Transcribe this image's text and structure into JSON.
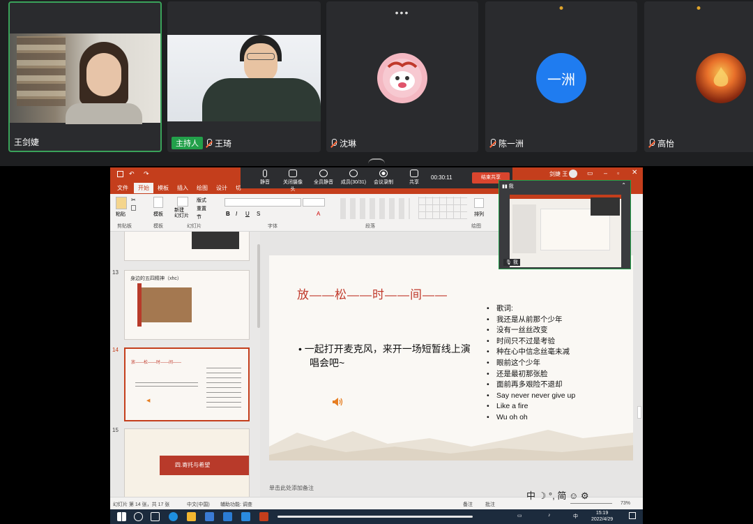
{
  "meeting": {
    "participants": [
      {
        "name": "王剑婕",
        "host": false
      },
      {
        "name": "王琦",
        "host": true,
        "host_badge": "主持人"
      },
      {
        "name": "沈琳"
      },
      {
        "name": "陈一洲",
        "avatar_text": "一洲"
      },
      {
        "name": "高怡"
      }
    ],
    "controls": [
      {
        "label": "静音",
        "icon": "mic-icon"
      },
      {
        "label": "关闭摄像头",
        "icon": "camera-icon"
      },
      {
        "label": "全员静音",
        "icon": "mute-all-icon"
      },
      {
        "label": "成员(30/31)",
        "icon": "members-icon"
      },
      {
        "label": "会议录制",
        "icon": "record-icon"
      },
      {
        "label": "共享",
        "icon": "share-icon"
      }
    ],
    "timer": "00:30:11",
    "stop_share_label": "结束共享",
    "preview_header_icon": "我",
    "preview_mic_label": "我",
    "colors": {
      "accent": "#22a04a",
      "stop": "#d9452e",
      "avatar_blue": "#1f7cf0"
    }
  },
  "ppt": {
    "user_name": "剑婕 王",
    "tabs": [
      "文件",
      "开始",
      "模板",
      "插入",
      "绘图",
      "设计",
      "切"
    ],
    "active_tab": "开始",
    "ribbon": {
      "paste": "粘贴",
      "template": "模板",
      "new_slide": "新建\n幻灯片",
      "layout": "版式",
      "reset": "重置",
      "section": "节",
      "groups": [
        "剪贴板",
        "模板",
        "幻灯片",
        "字体",
        "段落",
        "绘图"
      ],
      "arrange": "排列"
    },
    "thumbnails": [
      {
        "num": "13",
        "title": "身边的五四精神（xhc）"
      },
      {
        "num": "14",
        "title": "放——松——时——间——",
        "selected": true
      },
      {
        "num": "15",
        "title": "四.寄托与希望"
      }
    ],
    "slide": {
      "title": "放——松——时——间——",
      "bullet": "一起打开麦克风，来开一场短暂线上演唱会吧~",
      "lyrics": [
        "歌词:",
        "我还是从前那个少年",
        "没有一丝丝改变",
        "时间只不过是考验",
        "种在心中信念丝毫未减",
        "眼前这个少年",
        "还是最初那张脸",
        "面前再多艰险不退却",
        "Say never never give up",
        "Like a fire",
        "Wu oh oh"
      ]
    },
    "notes_placeholder": "单击此处添加备注",
    "status": {
      "slide_count": "幻灯片 第 14 张，共 17 张",
      "language": "中文(中国)",
      "accessibility": "辅助功能: 调查",
      "notes": "备注",
      "comments": "批注",
      "zoom": "73%"
    },
    "colors": {
      "ribbon": "#c43e1c",
      "title_red": "#c0392b"
    }
  },
  "ime": {
    "items": [
      "中",
      "☽",
      "°,",
      "简",
      "☺",
      "⚙"
    ]
  },
  "taskbar": {
    "time": "15:19",
    "date": "2022/4/29",
    "lang": "中"
  }
}
